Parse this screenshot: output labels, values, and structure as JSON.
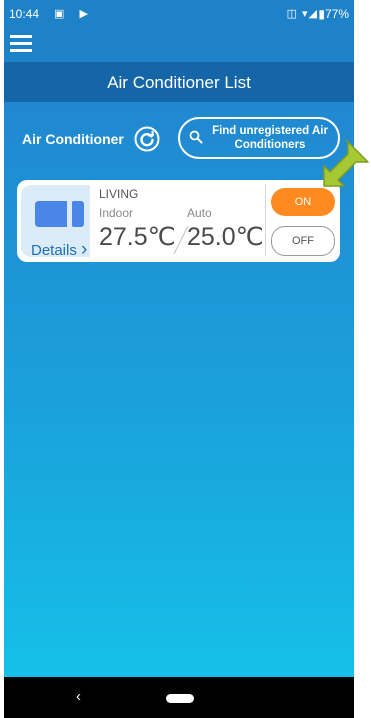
{
  "status_bar": {
    "time": "10:44",
    "left_icons": "▣ ▶",
    "right_icons": "◫ ▾◢",
    "battery": "▮77%"
  },
  "header": {
    "title": "Air Conditioner List"
  },
  "section": {
    "label": "Air Conditioner",
    "find_button_label": "Find unregistered Air Conditioners"
  },
  "ac_card": {
    "room_name": "LIVING",
    "indoor_label": "Indoor",
    "indoor_temp": "27.5℃",
    "mode_label": "Auto",
    "set_temp": "25.0℃",
    "details_label": "Details",
    "details_chevron": "›",
    "on_label": "ON",
    "off_label": "OFF"
  },
  "nav": {
    "back_glyph": "‹"
  },
  "colors": {
    "header_blue": "#1566a8",
    "status_blue": "#1e82c8",
    "on_orange": "#ff8a1f",
    "details_blue": "#1f6fb8",
    "arrow_green": "#a6c832"
  }
}
